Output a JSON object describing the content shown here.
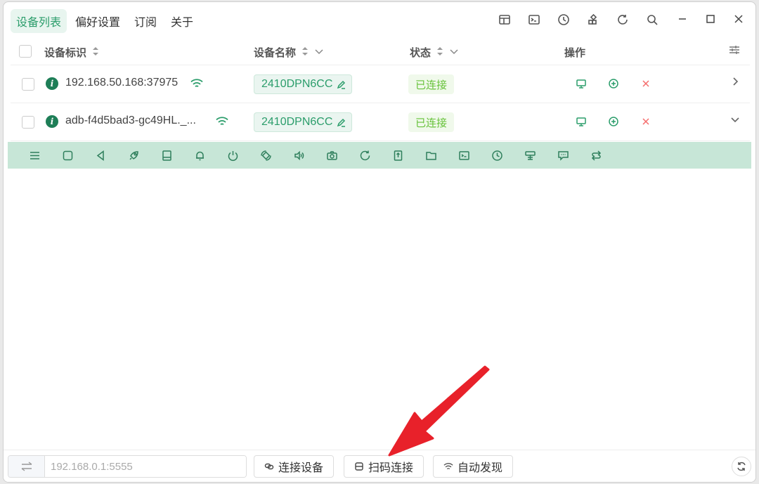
{
  "menu": {
    "items": [
      {
        "label": "设备列表",
        "active": true
      },
      {
        "label": "偏好设置",
        "active": false
      },
      {
        "label": "订阅",
        "active": false
      },
      {
        "label": "关于",
        "active": false
      }
    ]
  },
  "toolbar": {
    "icons": [
      "layout-icon",
      "terminal-icon",
      "clock-icon",
      "dock-icon",
      "refresh-icon",
      "search-icon"
    ]
  },
  "window_controls": [
    "minimize-icon",
    "maximize-icon",
    "close-icon"
  ],
  "table": {
    "headers": {
      "serial": "设备标识",
      "name": "设备名称",
      "status": "状态",
      "actions": "操作"
    },
    "rows": [
      {
        "serial": "192.168.50.168:37975",
        "name": "2410DPN6CC",
        "status": "已连接",
        "expanded": false
      },
      {
        "serial": "adb-f4d5bad3-gc49HL._...",
        "name": "2410DPN6CC",
        "status": "已连接",
        "expanded": true
      }
    ]
  },
  "control_bar": {
    "icons": [
      "menu-icon",
      "home-icon",
      "back-icon",
      "rocket-icon",
      "notification-bar-icon",
      "bell-icon",
      "power-icon",
      "rotate-icon",
      "volume-icon",
      "camera-icon",
      "reboot-icon",
      "install-apk-icon",
      "folder-icon",
      "shell-icon",
      "history-icon",
      "display-icon",
      "message-icon",
      "switch-icon"
    ]
  },
  "bottom": {
    "address_placeholder": "192.168.0.1:5555",
    "connect_label": "连接设备",
    "qr_label": "扫码连接",
    "discover_label": "自动发现"
  },
  "colors": {
    "accent": "#2b9d6b",
    "status_green": "#67c23a",
    "control_bar_bg": "#c7e6d7",
    "arrow_red": "#e8212a"
  }
}
